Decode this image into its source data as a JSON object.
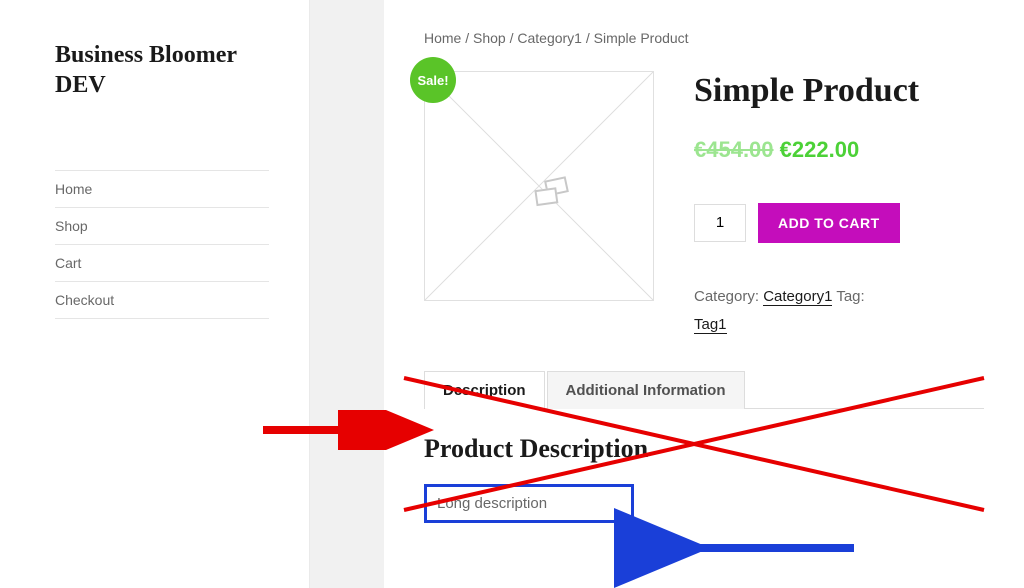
{
  "site": {
    "title": "Business Bloomer DEV"
  },
  "nav": {
    "items": [
      {
        "label": "Home"
      },
      {
        "label": "Shop"
      },
      {
        "label": "Cart"
      },
      {
        "label": "Checkout"
      }
    ]
  },
  "breadcrumb": "Home / Shop / Category1 / Simple Product",
  "product": {
    "sale_badge": "Sale!",
    "title": "Simple Product",
    "old_price": "€454.00",
    "new_price": "€222.00",
    "qty": "1",
    "add_to_cart": "ADD TO CART",
    "meta": {
      "category_label": "Category:",
      "category_value": "Category1",
      "tag_label": "Tag:",
      "tag_value": "Tag1"
    }
  },
  "tabs": {
    "description": "Description",
    "additional": "Additional Information"
  },
  "description": {
    "heading": "Product Description",
    "body": "Long description"
  }
}
